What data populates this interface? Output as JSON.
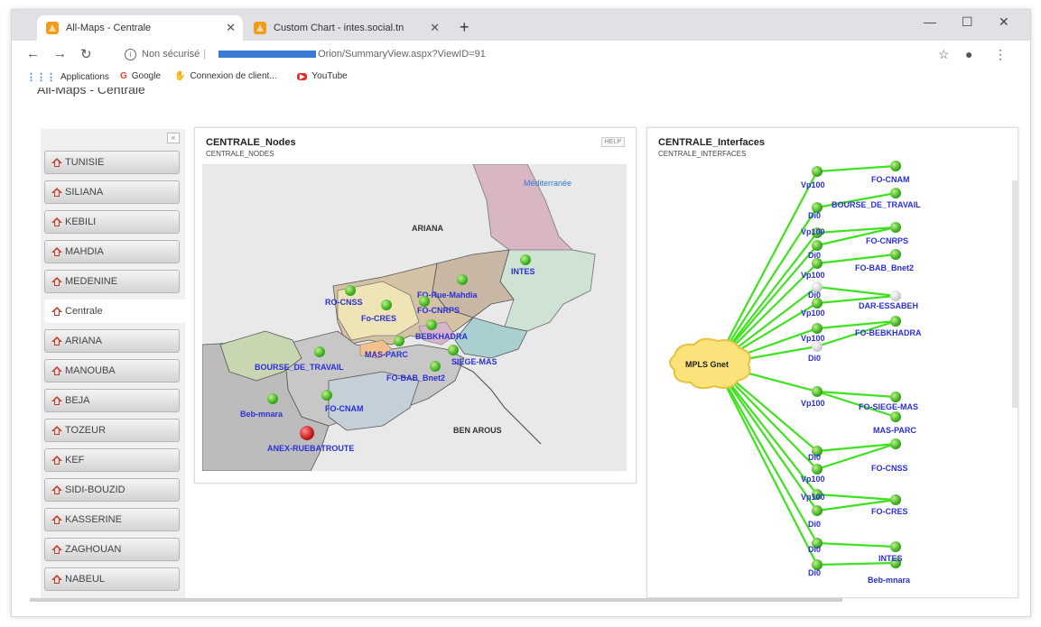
{
  "browser": {
    "tabs": [
      {
        "title": "All-Maps - Centrale"
      },
      {
        "title": "Custom Chart - intes.social.tn"
      }
    ],
    "new_tab_symbol": "+",
    "address": {
      "security_label": "Non sécurisé",
      "url_tail": "Orion/SummaryView.aspx?ViewID=91"
    },
    "bookmarks": [
      {
        "label": "Applications",
        "icon": "apps-grid-icon"
      },
      {
        "label": "Google",
        "icon": "google-icon"
      },
      {
        "label": "Connexion de client...",
        "icon": "hand-icon"
      },
      {
        "label": "YouTube",
        "icon": "youtube-icon"
      }
    ]
  },
  "page": {
    "title": "All-Maps - Centrale"
  },
  "sidebar": {
    "collapse_symbol": "«",
    "items": [
      {
        "label": "TUNISIE",
        "active": false
      },
      {
        "label": "SILIANA",
        "active": false
      },
      {
        "label": "KEBILI",
        "active": false
      },
      {
        "label": "MAHDIA",
        "active": false
      },
      {
        "label": "MEDENINE",
        "active": false
      },
      {
        "label": "Centrale",
        "active": true
      },
      {
        "label": "ARIANA",
        "active": false
      },
      {
        "label": "MANOUBA",
        "active": false
      },
      {
        "label": "BEJA",
        "active": false
      },
      {
        "label": "TOZEUR",
        "active": false
      },
      {
        "label": "KEF",
        "active": false
      },
      {
        "label": "SIDI-BOUZID",
        "active": false
      },
      {
        "label": "KASSERINE",
        "active": false
      },
      {
        "label": "ZAGHOUAN",
        "active": false
      },
      {
        "label": "NABEUL",
        "active": false
      }
    ]
  },
  "nodes_panel": {
    "title": "CENTRALE_Nodes",
    "subtitle": "CENTRALE_NODES",
    "help": "HELP",
    "region_labels": {
      "sea": "Méditerranée",
      "north": "ARIANA",
      "south": "BEN AROUS"
    },
    "nodes": {
      "intes": "INTES",
      "fo_rue_mahdia": "FO-Rue-Mahdia",
      "ro_cnss": "RO-CNSS",
      "fo_cres": "Fo-CRES",
      "fo_cnrps": "FO-CNRPS",
      "bebkhadra": "BEBKHADRA",
      "mas_parc": "MAS-PARC",
      "siege_mas": "SIEGE-MAS",
      "bourse": "BOURSE_DE_TRAVAIL",
      "fo_bab_bnet": "FO-BAB_Bnet2",
      "fo_cnam": "FO-CNAM",
      "beb_mnara": "Beb-mnara",
      "anex": "ANEX-RUEBATROUTE"
    }
  },
  "interfaces_panel": {
    "title": "CENTRALE_Interfaces",
    "subtitle": "CENTRALE_INTERFACES",
    "hub": "MPLS Gnet",
    "interface_labels": [
      "Vp100",
      "Di0",
      "Vp100",
      "Di0",
      "Vp100",
      "Di0",
      "Vp100",
      "Vp100",
      "Di0",
      "Vp100",
      "Di0",
      "Vp100",
      "Vp100",
      "Di0",
      "Di0",
      "Di0"
    ],
    "targets": [
      "FO-CNAM",
      "BOURSE_DE_TRAVAIL",
      "FO-CNRPS",
      "FO-BAB_Bnet2",
      "DAR-ESSABEH",
      "FO-BEBKHADRA",
      "FO-SIEGE-MAS",
      "MAS-PARC",
      "FO-CNSS",
      "FO-CRES",
      "INTES",
      "Beb-mnara"
    ]
  }
}
